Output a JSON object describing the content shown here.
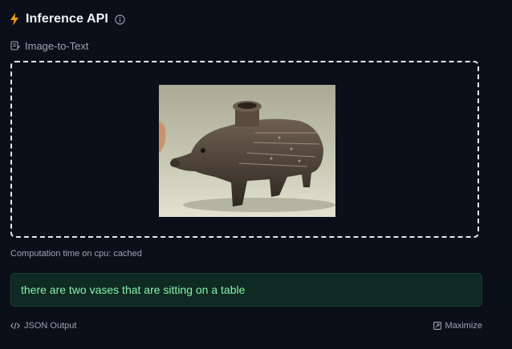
{
  "header": {
    "title": "Inference API",
    "icon": "bolt-icon",
    "accent_color": "#f59e0b"
  },
  "task": {
    "label": "Image-to-Text",
    "icon": "task-icon"
  },
  "dropzone": {
    "image_alt": "ceramic boar-shaped vessel"
  },
  "compute_time": "Computation time on cpu: cached",
  "result": {
    "text": "there are two vases that are sitting on a table"
  },
  "footer": {
    "json_output_label": "JSON Output",
    "maximize_label": "Maximize"
  }
}
